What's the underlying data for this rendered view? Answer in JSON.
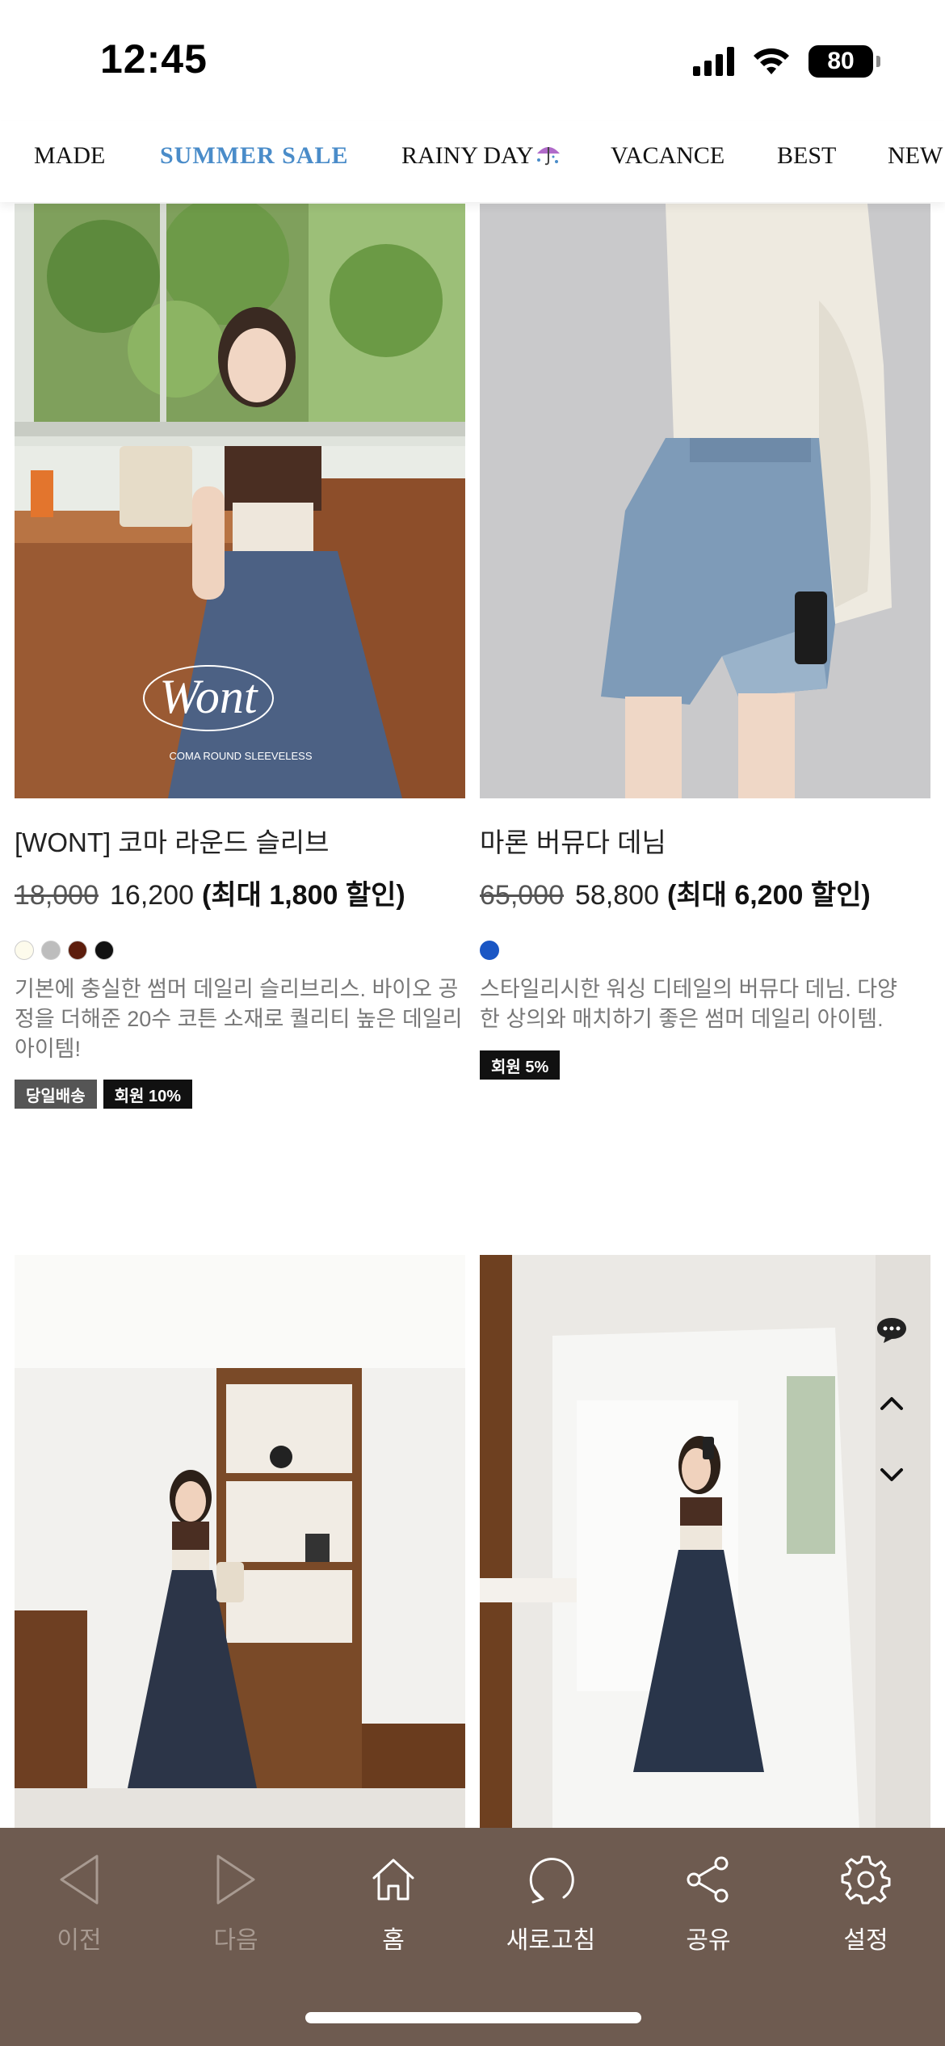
{
  "status_bar": {
    "time": "12:45",
    "battery": "80"
  },
  "category_nav": {
    "items": [
      {
        "label": "MADE",
        "active": false
      },
      {
        "label": "SUMMER SALE",
        "active": true
      },
      {
        "label": "RAINY DAY",
        "active": false,
        "icon": "umbrella-icon"
      },
      {
        "label": "VACANCE",
        "active": false
      },
      {
        "label": "BEST",
        "active": false
      },
      {
        "label": "NEW",
        "active": false
      }
    ]
  },
  "products": [
    {
      "image_overlay_logo": "Wont",
      "image_overlay_caption": "COMA ROUND SLEEVELESS",
      "name": "[WONT] 코마 라운드 슬리브",
      "price_old": "18,000",
      "price_new": "16,200",
      "discount": "(최대 1,800 할인)",
      "colors": [
        "#fdfbec",
        "#bdbdbd",
        "#5c1d0c",
        "#111111"
      ],
      "description": "기본에 충실한 썸머 데일리 슬리브리스. 바이오 공정을 더해준 20수 코튼 소재로 퀄리티 높은 데일리 아이템!",
      "badges": [
        {
          "label": "당일배송",
          "color": "#555555"
        },
        {
          "label": "회원 10%",
          "color": "#111111"
        }
      ]
    },
    {
      "name": "마론 버뮤다 데님",
      "price_old": "65,000",
      "price_new": "58,800",
      "discount": "(최대 6,200 할인)",
      "colors": [
        "#1a56c4"
      ],
      "description": "스타일리시한 워싱 디테일의 버뮤다 데님. 다양한 상의와 매치하기 좋은 썸머 데일리 아이템.",
      "badges": [
        {
          "label": "회원 5%",
          "color": "#111111"
        }
      ]
    }
  ],
  "toolbar": {
    "items": [
      {
        "label": "이전",
        "icon": "back-triangle-icon",
        "enabled": false
      },
      {
        "label": "다음",
        "icon": "forward-triangle-icon",
        "enabled": false
      },
      {
        "label": "홈",
        "icon": "home-icon",
        "enabled": true
      },
      {
        "label": "새로고침",
        "icon": "refresh-icon",
        "enabled": true
      },
      {
        "label": "공유",
        "icon": "share-icon",
        "enabled": true
      },
      {
        "label": "설정",
        "icon": "gear-icon",
        "enabled": true
      }
    ],
    "background": "#6e5b50"
  },
  "colors": {
    "accent": "#4a8cc9"
  }
}
